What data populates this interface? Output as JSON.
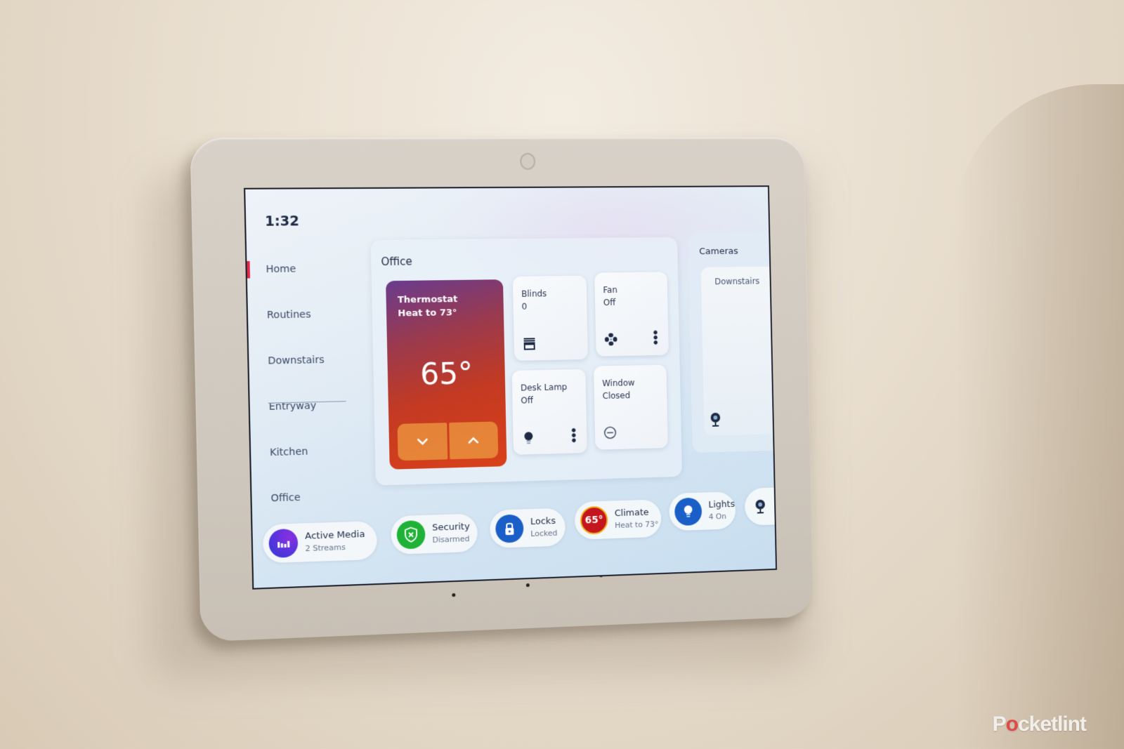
{
  "screen": {
    "time": "1:32"
  },
  "sidebar": {
    "active_index": 0,
    "accent_color": "#e0284a",
    "items": [
      {
        "label": "Home",
        "active": true
      },
      {
        "label": "Routines"
      },
      {
        "label": "Downstairs"
      },
      {
        "label": "Entryway"
      },
      {
        "label": "Kitchen"
      },
      {
        "label": "Office"
      }
    ]
  },
  "office": {
    "title": "Office",
    "thermostat": {
      "name": "Thermostat",
      "mode": "Heat to 73°",
      "current_temp": "65°",
      "down_icon": "chevron-down-icon",
      "up_icon": "chevron-up-icon",
      "down_glyph": "⌄",
      "up_glyph": "⌃"
    },
    "tiles": [
      {
        "name": "Blinds",
        "state": "0",
        "icon": "blinds-icon"
      },
      {
        "name": "Fan",
        "state": "Off",
        "icon": "fan-icon",
        "has_more": true
      },
      {
        "name": "Desk Lamp",
        "state": "Off",
        "icon": "bulb-icon",
        "has_more": true
      },
      {
        "name": "Window",
        "state": "Closed",
        "icon": "minus-circle-icon"
      }
    ],
    "more_glyph": "•••"
  },
  "cameras": {
    "title": "Cameras",
    "items": [
      {
        "name": "Downstairs",
        "icon": "camera-icon"
      }
    ]
  },
  "status_bar": [
    {
      "label": "Active Media",
      "sub": "2 Streams",
      "icon": "media-icon",
      "color": "#5b2fd6"
    },
    {
      "label": "Security",
      "sub": "Disarmed",
      "icon": "shield-x-icon",
      "color": "#1fb236"
    },
    {
      "label": "Locks",
      "sub": "Locked",
      "icon": "lock-icon",
      "color": "#1a5fc8"
    },
    {
      "label": "Climate",
      "sub": "Heat to 73°",
      "icon": "temperature-icon",
      "color": "#c4161c",
      "icon_text": "65°"
    },
    {
      "label": "Lights",
      "sub": "4 On",
      "icon": "bulb-icon",
      "color": "#1a5fc8"
    },
    {
      "label": "",
      "sub": "",
      "icon": "camera-icon",
      "color": "#f5f8fb"
    }
  ],
  "watermark": {
    "prefix": "P",
    "o": "o",
    "suffix": "cketlint"
  }
}
